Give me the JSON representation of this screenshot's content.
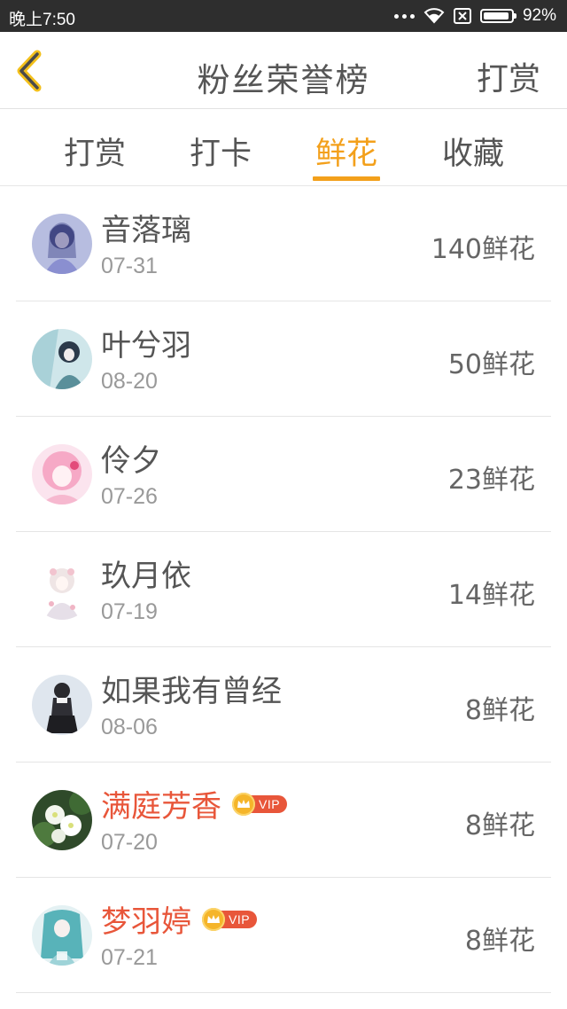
{
  "status_bar": {
    "time": "晚上7:50",
    "battery": "92%",
    "battery_level": 0.92
  },
  "header": {
    "title": "粉丝荣誉榜",
    "action_label": "打赏",
    "back_icon": "chevron-left-icon",
    "accent": "#f3a01b"
  },
  "tabs": [
    {
      "label": "打赏",
      "active": false
    },
    {
      "label": "打卡",
      "active": false
    },
    {
      "label": "鲜花",
      "active": true
    },
    {
      "label": "收藏",
      "active": false
    }
  ],
  "fans": [
    {
      "name": "音落璃",
      "date": "07-31",
      "count": "140鲜花",
      "vip": false
    },
    {
      "name": "叶兮羽",
      "date": "08-20",
      "count": "50鲜花",
      "vip": false
    },
    {
      "name": "伶夕",
      "date": "07-26",
      "count": "23鲜花",
      "vip": false
    },
    {
      "name": "玖月依",
      "date": "07-19",
      "count": "14鲜花",
      "vip": false
    },
    {
      "name": "如果我有曾经",
      "date": "08-06",
      "count": "8鲜花",
      "vip": false
    },
    {
      "name": "满庭芳香",
      "date": "07-20",
      "count": "8鲜花",
      "vip": true,
      "vip_label": "VIP"
    },
    {
      "name": "梦羽婷",
      "date": "07-21",
      "count": "8鲜花",
      "vip": true,
      "vip_label": "VIP"
    }
  ]
}
